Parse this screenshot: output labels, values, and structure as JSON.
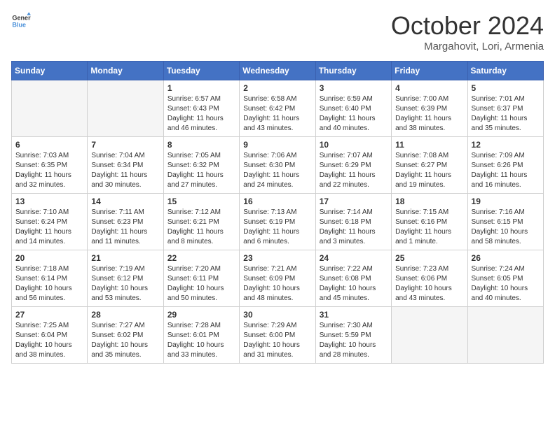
{
  "logo": {
    "line1": "General",
    "line2": "Blue"
  },
  "title": "October 2024",
  "subtitle": "Margahovit, Lori, Armenia",
  "days_of_week": [
    "Sunday",
    "Monday",
    "Tuesday",
    "Wednesday",
    "Thursday",
    "Friday",
    "Saturday"
  ],
  "weeks": [
    [
      {
        "day": "",
        "empty": true
      },
      {
        "day": "",
        "empty": true
      },
      {
        "day": "1",
        "sunrise": "Sunrise: 6:57 AM",
        "sunset": "Sunset: 6:43 PM",
        "daylight": "Daylight: 11 hours and 46 minutes."
      },
      {
        "day": "2",
        "sunrise": "Sunrise: 6:58 AM",
        "sunset": "Sunset: 6:42 PM",
        "daylight": "Daylight: 11 hours and 43 minutes."
      },
      {
        "day": "3",
        "sunrise": "Sunrise: 6:59 AM",
        "sunset": "Sunset: 6:40 PM",
        "daylight": "Daylight: 11 hours and 40 minutes."
      },
      {
        "day": "4",
        "sunrise": "Sunrise: 7:00 AM",
        "sunset": "Sunset: 6:39 PM",
        "daylight": "Daylight: 11 hours and 38 minutes."
      },
      {
        "day": "5",
        "sunrise": "Sunrise: 7:01 AM",
        "sunset": "Sunset: 6:37 PM",
        "daylight": "Daylight: 11 hours and 35 minutes."
      }
    ],
    [
      {
        "day": "6",
        "sunrise": "Sunrise: 7:03 AM",
        "sunset": "Sunset: 6:35 PM",
        "daylight": "Daylight: 11 hours and 32 minutes."
      },
      {
        "day": "7",
        "sunrise": "Sunrise: 7:04 AM",
        "sunset": "Sunset: 6:34 PM",
        "daylight": "Daylight: 11 hours and 30 minutes."
      },
      {
        "day": "8",
        "sunrise": "Sunrise: 7:05 AM",
        "sunset": "Sunset: 6:32 PM",
        "daylight": "Daylight: 11 hours and 27 minutes."
      },
      {
        "day": "9",
        "sunrise": "Sunrise: 7:06 AM",
        "sunset": "Sunset: 6:30 PM",
        "daylight": "Daylight: 11 hours and 24 minutes."
      },
      {
        "day": "10",
        "sunrise": "Sunrise: 7:07 AM",
        "sunset": "Sunset: 6:29 PM",
        "daylight": "Daylight: 11 hours and 22 minutes."
      },
      {
        "day": "11",
        "sunrise": "Sunrise: 7:08 AM",
        "sunset": "Sunset: 6:27 PM",
        "daylight": "Daylight: 11 hours and 19 minutes."
      },
      {
        "day": "12",
        "sunrise": "Sunrise: 7:09 AM",
        "sunset": "Sunset: 6:26 PM",
        "daylight": "Daylight: 11 hours and 16 minutes."
      }
    ],
    [
      {
        "day": "13",
        "sunrise": "Sunrise: 7:10 AM",
        "sunset": "Sunset: 6:24 PM",
        "daylight": "Daylight: 11 hours and 14 minutes."
      },
      {
        "day": "14",
        "sunrise": "Sunrise: 7:11 AM",
        "sunset": "Sunset: 6:23 PM",
        "daylight": "Daylight: 11 hours and 11 minutes."
      },
      {
        "day": "15",
        "sunrise": "Sunrise: 7:12 AM",
        "sunset": "Sunset: 6:21 PM",
        "daylight": "Daylight: 11 hours and 8 minutes."
      },
      {
        "day": "16",
        "sunrise": "Sunrise: 7:13 AM",
        "sunset": "Sunset: 6:19 PM",
        "daylight": "Daylight: 11 hours and 6 minutes."
      },
      {
        "day": "17",
        "sunrise": "Sunrise: 7:14 AM",
        "sunset": "Sunset: 6:18 PM",
        "daylight": "Daylight: 11 hours and 3 minutes."
      },
      {
        "day": "18",
        "sunrise": "Sunrise: 7:15 AM",
        "sunset": "Sunset: 6:16 PM",
        "daylight": "Daylight: 11 hours and 1 minute."
      },
      {
        "day": "19",
        "sunrise": "Sunrise: 7:16 AM",
        "sunset": "Sunset: 6:15 PM",
        "daylight": "Daylight: 10 hours and 58 minutes."
      }
    ],
    [
      {
        "day": "20",
        "sunrise": "Sunrise: 7:18 AM",
        "sunset": "Sunset: 6:14 PM",
        "daylight": "Daylight: 10 hours and 56 minutes."
      },
      {
        "day": "21",
        "sunrise": "Sunrise: 7:19 AM",
        "sunset": "Sunset: 6:12 PM",
        "daylight": "Daylight: 10 hours and 53 minutes."
      },
      {
        "day": "22",
        "sunrise": "Sunrise: 7:20 AM",
        "sunset": "Sunset: 6:11 PM",
        "daylight": "Daylight: 10 hours and 50 minutes."
      },
      {
        "day": "23",
        "sunrise": "Sunrise: 7:21 AM",
        "sunset": "Sunset: 6:09 PM",
        "daylight": "Daylight: 10 hours and 48 minutes."
      },
      {
        "day": "24",
        "sunrise": "Sunrise: 7:22 AM",
        "sunset": "Sunset: 6:08 PM",
        "daylight": "Daylight: 10 hours and 45 minutes."
      },
      {
        "day": "25",
        "sunrise": "Sunrise: 7:23 AM",
        "sunset": "Sunset: 6:06 PM",
        "daylight": "Daylight: 10 hours and 43 minutes."
      },
      {
        "day": "26",
        "sunrise": "Sunrise: 7:24 AM",
        "sunset": "Sunset: 6:05 PM",
        "daylight": "Daylight: 10 hours and 40 minutes."
      }
    ],
    [
      {
        "day": "27",
        "sunrise": "Sunrise: 7:25 AM",
        "sunset": "Sunset: 6:04 PM",
        "daylight": "Daylight: 10 hours and 38 minutes."
      },
      {
        "day": "28",
        "sunrise": "Sunrise: 7:27 AM",
        "sunset": "Sunset: 6:02 PM",
        "daylight": "Daylight: 10 hours and 35 minutes."
      },
      {
        "day": "29",
        "sunrise": "Sunrise: 7:28 AM",
        "sunset": "Sunset: 6:01 PM",
        "daylight": "Daylight: 10 hours and 33 minutes."
      },
      {
        "day": "30",
        "sunrise": "Sunrise: 7:29 AM",
        "sunset": "Sunset: 6:00 PM",
        "daylight": "Daylight: 10 hours and 31 minutes."
      },
      {
        "day": "31",
        "sunrise": "Sunrise: 7:30 AM",
        "sunset": "Sunset: 5:59 PM",
        "daylight": "Daylight: 10 hours and 28 minutes."
      },
      {
        "day": "",
        "empty": true
      },
      {
        "day": "",
        "empty": true
      }
    ]
  ]
}
